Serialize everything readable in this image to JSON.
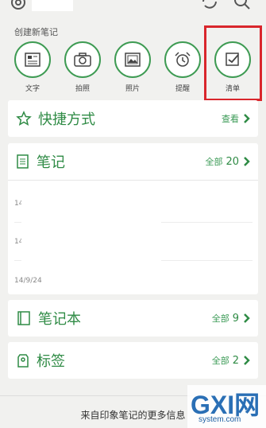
{
  "create": {
    "label": "创建新笔记",
    "items": [
      {
        "label": "文字",
        "icon": "text-note-icon"
      },
      {
        "label": "拍照",
        "icon": "camera-icon"
      },
      {
        "label": "照片",
        "icon": "photo-icon"
      },
      {
        "label": "提醒",
        "icon": "alarm-clock-icon"
      },
      {
        "label": "清单",
        "icon": "checklist-icon"
      }
    ]
  },
  "shortcuts": {
    "title": "快捷方式",
    "action": "查看"
  },
  "notes": {
    "title": "笔记",
    "action": "全部",
    "count": "20",
    "fragments": [
      "14",
      "14"
    ],
    "date": "14/9/24"
  },
  "notebooks": {
    "title": "笔记本",
    "action": "全部",
    "count": "9"
  },
  "tags": {
    "title": "标签",
    "action": "全部",
    "count": "2"
  },
  "footer": {
    "text": "来自印象笔记的更多信息"
  },
  "watermark": {
    "big": "GXI网",
    "small": "system.com"
  },
  "colors": {
    "accent": "#2f8b45",
    "highlight": "#d9262c",
    "background": "#f1f1ef"
  }
}
